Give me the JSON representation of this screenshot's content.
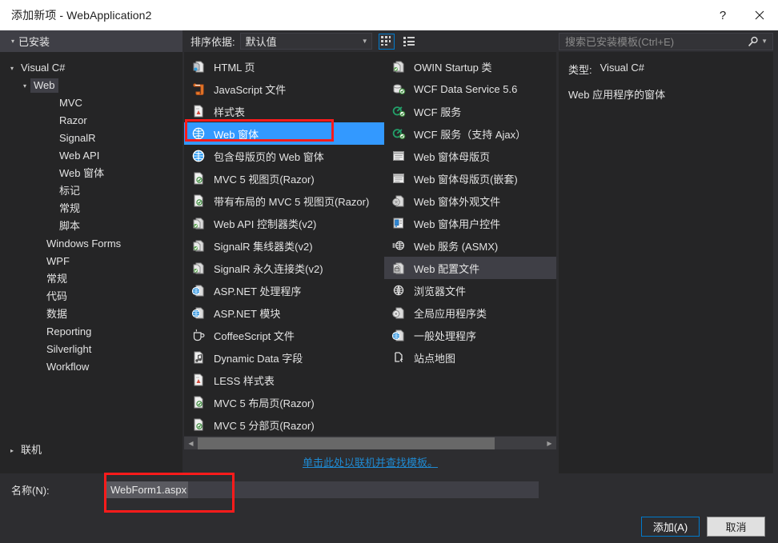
{
  "window": {
    "title": "添加新项 - WebApplication2",
    "help_label": "?",
    "close_label": "✕",
    "help_icon": "question-mark-icon",
    "close_icon": "close-icon"
  },
  "sidebar": {
    "header": "已安装",
    "items": [
      {
        "label": "Visual C#",
        "indent": 0,
        "state": "open",
        "selected": false
      },
      {
        "label": "Web",
        "indent": 1,
        "state": "open",
        "selected": true
      },
      {
        "label": "MVC",
        "indent": 3,
        "state": "none",
        "selected": false
      },
      {
        "label": "Razor",
        "indent": 3,
        "state": "none",
        "selected": false
      },
      {
        "label": "SignalR",
        "indent": 3,
        "state": "none",
        "selected": false
      },
      {
        "label": "Web API",
        "indent": 3,
        "state": "none",
        "selected": false
      },
      {
        "label": "Web 窗体",
        "indent": 3,
        "state": "none",
        "selected": false
      },
      {
        "label": "标记",
        "indent": 3,
        "state": "none",
        "selected": false
      },
      {
        "label": "常规",
        "indent": 3,
        "state": "none",
        "selected": false
      },
      {
        "label": "脚本",
        "indent": 3,
        "state": "none",
        "selected": false
      },
      {
        "label": "Windows Forms",
        "indent": 2,
        "state": "none",
        "selected": false
      },
      {
        "label": "WPF",
        "indent": 2,
        "state": "none",
        "selected": false
      },
      {
        "label": "常规",
        "indent": 2,
        "state": "none",
        "selected": false
      },
      {
        "label": "代码",
        "indent": 2,
        "state": "none",
        "selected": false
      },
      {
        "label": "数据",
        "indent": 2,
        "state": "none",
        "selected": false
      },
      {
        "label": "Reporting",
        "indent": 2,
        "state": "none",
        "selected": false
      },
      {
        "label": "Silverlight",
        "indent": 2,
        "state": "none",
        "selected": false
      },
      {
        "label": "Workflow",
        "indent": 2,
        "state": "none",
        "selected": false
      }
    ],
    "online_node": {
      "label": "联机",
      "state": "closed"
    }
  },
  "toolbar": {
    "sort_label": "排序依据:",
    "sort_value": "默认值",
    "caret_icon": "chevron-down-icon",
    "grid_view_icon": "grid-view-icon",
    "list_view_icon": "list-view-icon",
    "active_view": "grid"
  },
  "templates": {
    "column1": [
      {
        "label": "HTML 页",
        "icon": "html-page-icon",
        "state": "normal"
      },
      {
        "label": "JavaScript 文件",
        "icon": "javascript-file-icon",
        "state": "normal"
      },
      {
        "label": "样式表",
        "icon": "stylesheet-icon",
        "state": "normal"
      },
      {
        "label": "Web 窗体",
        "icon": "web-form-icon",
        "state": "selected"
      },
      {
        "label": "包含母版页的 Web 窗体",
        "icon": "web-form-icon",
        "state": "normal"
      },
      {
        "label": "MVC 5 视图页(Razor)",
        "icon": "razor-view-icon",
        "state": "normal"
      },
      {
        "label": "带有布局的 MVC 5 视图页(Razor)",
        "icon": "razor-view-icon",
        "state": "normal"
      },
      {
        "label": "Web API 控制器类(v2)",
        "icon": "class-green-icon",
        "state": "normal"
      },
      {
        "label": "SignalR 集线器类(v2)",
        "icon": "class-green-icon",
        "state": "normal"
      },
      {
        "label": "SignalR 永久连接类(v2)",
        "icon": "class-green-icon",
        "state": "normal"
      },
      {
        "label": "ASP.NET 处理程序",
        "icon": "aspnet-globe-icon",
        "state": "normal"
      },
      {
        "label": "ASP.NET 模块",
        "icon": "aspnet-globe-icon",
        "state": "normal"
      },
      {
        "label": "CoffeeScript 文件",
        "icon": "coffee-cup-icon",
        "state": "normal"
      },
      {
        "label": "Dynamic Data 字段",
        "icon": "dynamic-data-icon",
        "state": "normal"
      },
      {
        "label": "LESS 样式表",
        "icon": "stylesheet-icon",
        "state": "normal"
      },
      {
        "label": "MVC 5 布局页(Razor)",
        "icon": "razor-view-icon",
        "state": "normal"
      },
      {
        "label": "MVC 5 分部页(Razor)",
        "icon": "razor-view-icon",
        "state": "normal"
      }
    ],
    "column2": [
      {
        "label": "OWIN Startup 类",
        "icon": "class-green-icon",
        "state": "normal"
      },
      {
        "label": "WCF Data Service 5.6",
        "icon": "wcf-data-service-icon",
        "state": "normal"
      },
      {
        "label": "WCF 服务",
        "icon": "wcf-service-icon",
        "state": "normal"
      },
      {
        "label": "WCF 服务（支持 Ajax）",
        "icon": "wcf-service-icon",
        "state": "normal"
      },
      {
        "label": "Web 窗体母版页",
        "icon": "master-page-icon",
        "state": "normal"
      },
      {
        "label": "Web 窗体母版页(嵌套)",
        "icon": "master-page-icon",
        "state": "normal"
      },
      {
        "label": "Web 窗体外观文件",
        "icon": "skin-file-icon",
        "state": "normal"
      },
      {
        "label": "Web 窗体用户控件",
        "icon": "user-control-icon",
        "state": "normal"
      },
      {
        "label": "Web 服务 (ASMX)",
        "icon": "web-service-icon",
        "state": "normal"
      },
      {
        "label": "Web 配置文件",
        "icon": "config-file-icon",
        "state": "hover"
      },
      {
        "label": "浏览器文件",
        "icon": "browser-file-icon",
        "state": "normal"
      },
      {
        "label": "全局应用程序类",
        "icon": "global-app-icon",
        "state": "normal"
      },
      {
        "label": "一般处理程序",
        "icon": "aspnet-globe-icon",
        "state": "normal"
      },
      {
        "label": "站点地图",
        "icon": "sitemap-icon",
        "state": "normal"
      }
    ]
  },
  "scrollbar": {
    "left_arrow_icon": "triangle-left-icon",
    "right_arrow_icon": "triangle-right-icon"
  },
  "online_link": {
    "text": "单击此处以联机并查找模板。"
  },
  "search": {
    "placeholder": "搜索已安装模板(Ctrl+E)",
    "value": "",
    "search_icon": "search-magnifier-icon",
    "caret_icon": "chevron-down-icon"
  },
  "info": {
    "type_key": "类型:",
    "type_value": "Visual C#",
    "description": "Web 应用程序的窗体"
  },
  "footer": {
    "name_label": "名称(N):",
    "name_value": "WebForm1.aspx",
    "add_button": "添加(A)",
    "cancel_button": "取消"
  },
  "colors": {
    "accent_blue": "#007acc",
    "selection_blue": "#3399ff",
    "annotation_red": "#fe1b1b",
    "link_blue": "#1f8ad2",
    "dialog_bg": "#2d2d30",
    "pane_bg": "#252526"
  }
}
